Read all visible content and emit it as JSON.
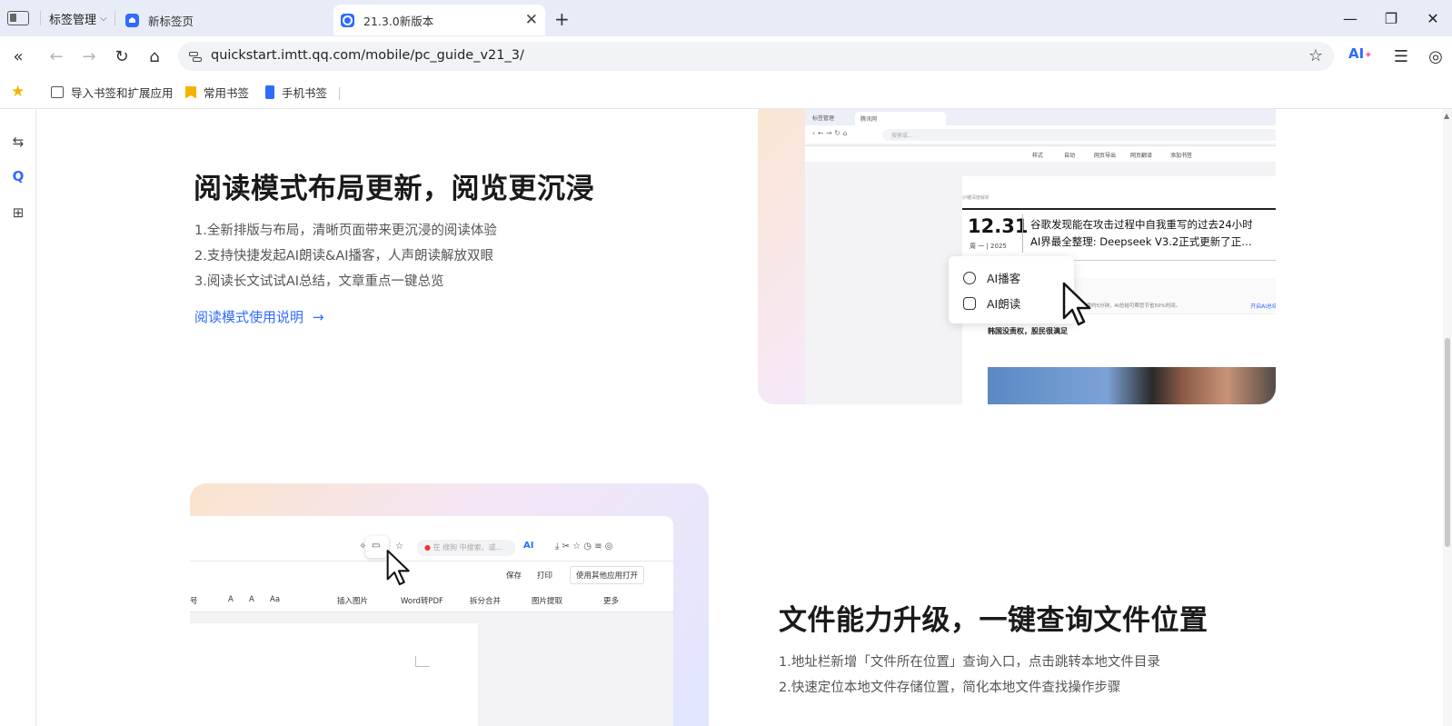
{
  "browser": {
    "tab_group_label": "标签管理",
    "tabs": [
      {
        "label": "新标签页"
      },
      {
        "label": "21.3.0新版本"
      }
    ],
    "url": "quickstart.imtt.qq.com/mobile/pc_guide_v21_3/",
    "ai_label": "AI",
    "bookmarks": [
      {
        "label": "导入书签和扩展应用"
      },
      {
        "label": "常用书签"
      },
      {
        "label": "手机书签"
      }
    ]
  },
  "section1": {
    "title": "阅读模式布局更新，阅览更沉浸",
    "bullets": [
      "1.全新排版与布局，清晰页面带来更沉浸的阅读体验",
      "2.支持快捷发起AI朗读&AI播客，人声朗读解放双眼",
      "3.阅读长文试试AI总结，文章重点一键总览"
    ],
    "link": "阅读模式使用说明",
    "screenshot": {
      "tab_group": "标签管理",
      "tab": "腾讯网",
      "search_placeholder": "搜索或...",
      "toolbar": [
        "样式",
        "自动",
        "网页导出",
        "网页翻译",
        "添加书签"
      ],
      "tag": "沙雕深度解析",
      "date": "12.31",
      "week": "周 一 | 2025",
      "headline1": "谷歌发现能在攻击过程中自我重写的过去24小时",
      "headline2": "AI界最全整理: Deepseek V3.2正式更新了正…",
      "ai_bar_text": "本篇文章约5分钟，AI总结可帮您节省50%时间。",
      "ai_bar_link": "开启AI总结",
      "subtitle": "韩国没责权，股民很满足",
      "popup": [
        "AI播客",
        "AI朗读"
      ]
    }
  },
  "section2": {
    "title": "文件能力升级，一键查询文件位置",
    "bullets": [
      "1.地址栏新增「文件所在位置」查询入口，点击跳转本地文件目录",
      "2.快速定位本地文件存储位置，简化本地文件查找操作步骤"
    ],
    "screenshot": {
      "search_placeholder": "在 搜狗 中搜索、或...",
      "ai_label": "AI",
      "toolbar1": [
        "保存",
        "打印",
        "使用其他应用打开"
      ],
      "toolbar2": [
        "号",
        "A",
        "A",
        "Aa",
        "插入图片",
        "Word转PDF",
        "拆分合并",
        "图片提取",
        "更多"
      ]
    }
  },
  "colors": {
    "accent": "#2f6bff",
    "titlebar": "#e8ecf7",
    "bookmark_star": "#f4b400"
  }
}
